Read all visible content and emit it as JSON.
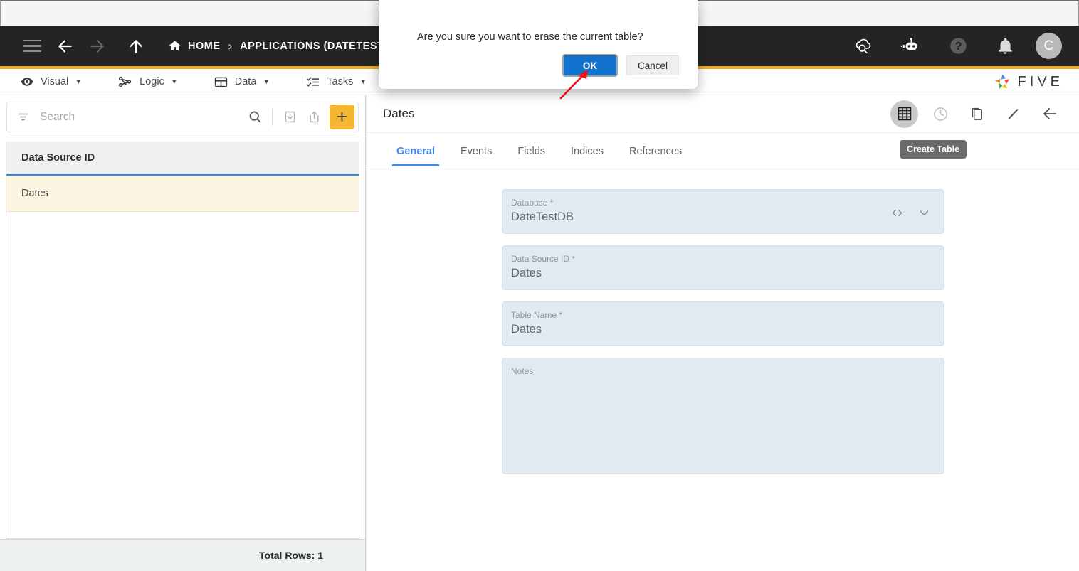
{
  "topbar": {
    "menu_icon": "hamburger-icon",
    "back_icon": "arrow-left-icon",
    "forward_icon": "arrow-right-icon",
    "up_icon": "arrow-up-icon",
    "breadcrumb": [
      {
        "label": "HOME",
        "icon": "home-icon"
      },
      {
        "label": "APPLICATIONS (DATETEST)",
        "icon": ""
      }
    ],
    "separator": "›",
    "actions": [
      {
        "name": "cloud-check-icon",
        "label": ""
      },
      {
        "name": "robot-chat-icon",
        "label": ""
      },
      {
        "name": "help-icon",
        "label": ""
      },
      {
        "name": "bell-icon",
        "label": ""
      }
    ],
    "avatar_letter": "C",
    "accent_color": "#f0a91e",
    "background_color": "#242424"
  },
  "menubar": {
    "items": [
      {
        "label": "Visual",
        "icon": "eye-icon",
        "caret": "▼"
      },
      {
        "label": "Logic",
        "icon": "logic-nodes-icon",
        "caret": "▼"
      },
      {
        "label": "Data",
        "icon": "table-icon",
        "caret": "▼"
      },
      {
        "label": "Tasks",
        "icon": "checklist-icon",
        "caret": "▼"
      }
    ],
    "brand": "FIVE"
  },
  "sidebar": {
    "search": {
      "placeholder": "Search",
      "value": ""
    },
    "filter_icon": "filter-icon",
    "search_icon": "search-icon",
    "import_icon": "import-icon",
    "export_icon": "export-icon",
    "add_label": "+",
    "column_header": "Data Source ID",
    "rows": [
      {
        "label": "Dates",
        "selected": true
      }
    ],
    "footer": "Total Rows: 1"
  },
  "detail": {
    "title": "Dates",
    "actions": [
      {
        "name": "create-table-icon",
        "active": true
      },
      {
        "name": "history-clock-icon",
        "active": false
      },
      {
        "name": "copy-icon",
        "active": false
      },
      {
        "name": "edit-pencil-icon",
        "active": false
      },
      {
        "name": "back-arrow-icon",
        "active": false
      }
    ],
    "tooltip": "Create Table",
    "tabs": [
      {
        "label": "General",
        "active": true
      },
      {
        "label": "Events",
        "active": false
      },
      {
        "label": "Fields",
        "active": false
      },
      {
        "label": "Indices",
        "active": false
      },
      {
        "label": "References",
        "active": false
      }
    ],
    "fields": [
      {
        "label": "Database *",
        "value": "DateTestDB",
        "icons": [
          "code-brackets-icon",
          "chevron-down-icon"
        ]
      },
      {
        "label": "Data Source ID *",
        "value": "Dates",
        "icons": []
      },
      {
        "label": "Table Name *",
        "value": "Dates",
        "icons": []
      },
      {
        "label": "Notes",
        "value": "",
        "icons": []
      }
    ],
    "field_bg_color": "#e2eaf1"
  },
  "dialog": {
    "message": "Are you sure you want to erase the current table?",
    "ok_label": "OK",
    "cancel_label": "Cancel",
    "ok_color": "#1273cf"
  },
  "annotation": {
    "arrow_color": "#e8131a"
  }
}
